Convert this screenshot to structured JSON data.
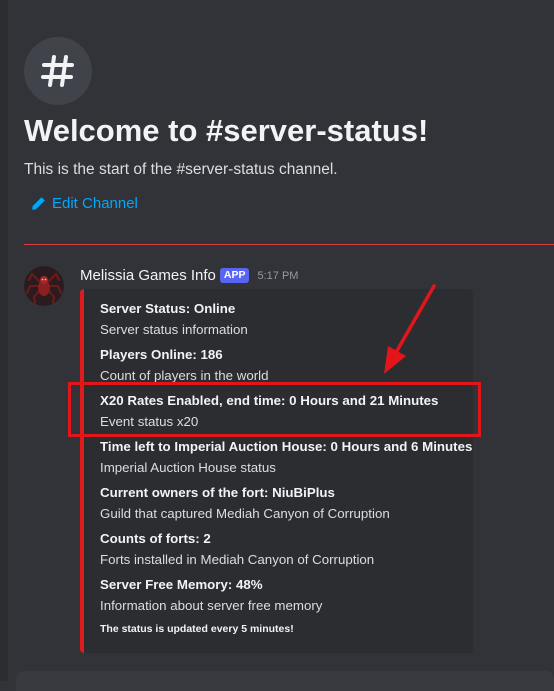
{
  "channel": {
    "hash_icon": "#",
    "welcome_title": "Welcome to #server-status!",
    "welcome_subtitle": "This is the start of the #server-status channel.",
    "edit_label": "Edit Channel"
  },
  "message": {
    "author": "Melissia Games Info",
    "badge": "APP",
    "time": "5:17 PM"
  },
  "embed": {
    "accent_color": "#e01b1b",
    "fields": [
      {
        "name": "Server Status: Online",
        "value": "Server status information"
      },
      {
        "name": "Players Online: 186",
        "value": "Count of players in the world"
      },
      {
        "name": "X20 Rates Enabled, end time: 0 Hours and 21 Minutes",
        "value": "Event status x20"
      },
      {
        "name": "Time left to Imperial Auction House: 0 Hours and 6 Minutes",
        "value": "Imperial Auction House status"
      },
      {
        "name": "Current owners of the fort: NiuBiPlus",
        "value": "Guild that captured Mediah Canyon of Corruption"
      },
      {
        "name": "Counts of forts: 2",
        "value": "Forts installed in Mediah Canyon of Corruption"
      },
      {
        "name": "Server Free Memory: 48%",
        "value": "Information about server free memory"
      }
    ],
    "footer": "The status is updated every 5 minutes!"
  },
  "annotation": {
    "color": "#e3151a",
    "highlighted_field_index": 2
  },
  "icons": {
    "edit": "pencil-icon",
    "avatar": "spider-avatar-icon"
  }
}
